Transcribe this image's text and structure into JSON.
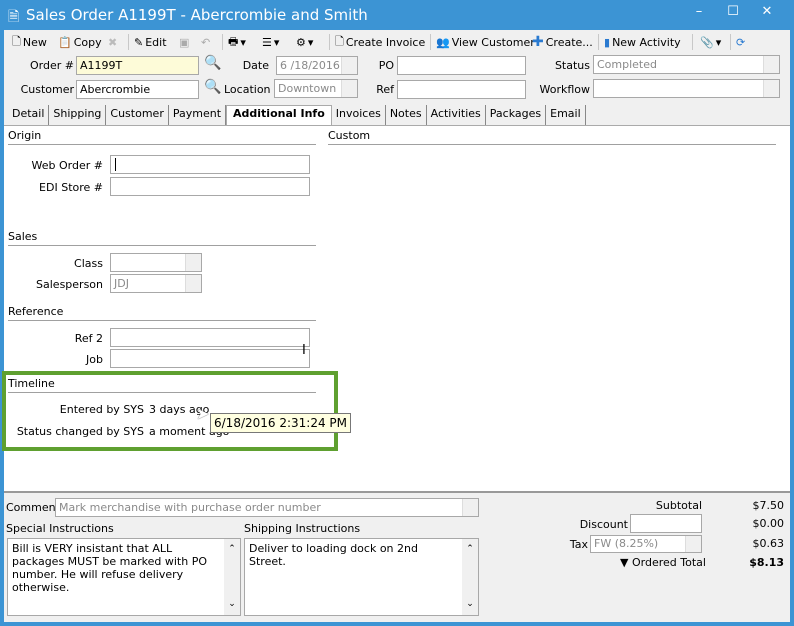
{
  "window": {
    "title": "Sales Order A1199T - Abercrombie and Smith",
    "accent": "#3c94d4",
    "highlight": "#5fa030"
  },
  "toolbar": {
    "new": "New",
    "copy": "Copy",
    "edit": "Edit",
    "create_invoice": "Create Invoice",
    "view_customer": "View Customer",
    "create": "Create...",
    "new_activity": "New Activity"
  },
  "header": {
    "order_label": "Order #",
    "order_value": "A1199T",
    "date_label": "Date",
    "date_value": "6 /18/2016",
    "po_label": "PO",
    "po_value": "",
    "status_label": "Status",
    "status_value": "Completed",
    "customer_label": "Customer",
    "customer_value": "Abercrombie",
    "location_label": "Location",
    "location_value": "Downtown",
    "ref_label": "Ref",
    "ref_value": "",
    "workflow_label": "Workflow",
    "workflow_value": ""
  },
  "tabs": [
    "Detail",
    "Shipping",
    "Customer",
    "Payment",
    "Additional Info",
    "Invoices",
    "Notes",
    "Activities",
    "Packages",
    "Email"
  ],
  "active_tab": "Additional Info",
  "origin": {
    "title": "Origin",
    "web_order_label": "Web Order #",
    "web_order_value": "",
    "edi_store_label": "EDI Store #",
    "edi_store_value": ""
  },
  "custom": {
    "title": "Custom"
  },
  "sales": {
    "title": "Sales",
    "class_label": "Class",
    "class_value": "",
    "salesperson_label": "Salesperson",
    "salesperson_value": "JDJ"
  },
  "reference": {
    "title": "Reference",
    "ref2_label": "Ref 2",
    "ref2_value": "",
    "job_label": "Job",
    "job_value": ""
  },
  "timeline": {
    "title": "Timeline",
    "entered_label": "Entered by SYS",
    "entered_value": "3 days ago",
    "status_label": "Status changed by SYS",
    "status_value": "a moment ago",
    "tooltip": "6/18/2016 2:31:24 PM"
  },
  "footer": {
    "comment_label": "Comment",
    "comment_placeholder": "Mark merchandise with purchase order number",
    "special_label": "Special Instructions",
    "special_text": "Bill is VERY insistant that ALL packages MUST be marked with PO number.  He will refuse delivery otherwise.",
    "shipping_label": "Shipping Instructions",
    "shipping_text": "Deliver to loading dock on 2nd Street.",
    "subtotal_label": "Subtotal",
    "subtotal": "$7.50",
    "discount_label": "Discount",
    "discount_value": "",
    "discount": "$0.00",
    "tax_label": "Tax",
    "tax_value": "FW (8.25%)",
    "tax": "$0.63",
    "total_label": "Ordered Total",
    "total": "$8.13"
  }
}
